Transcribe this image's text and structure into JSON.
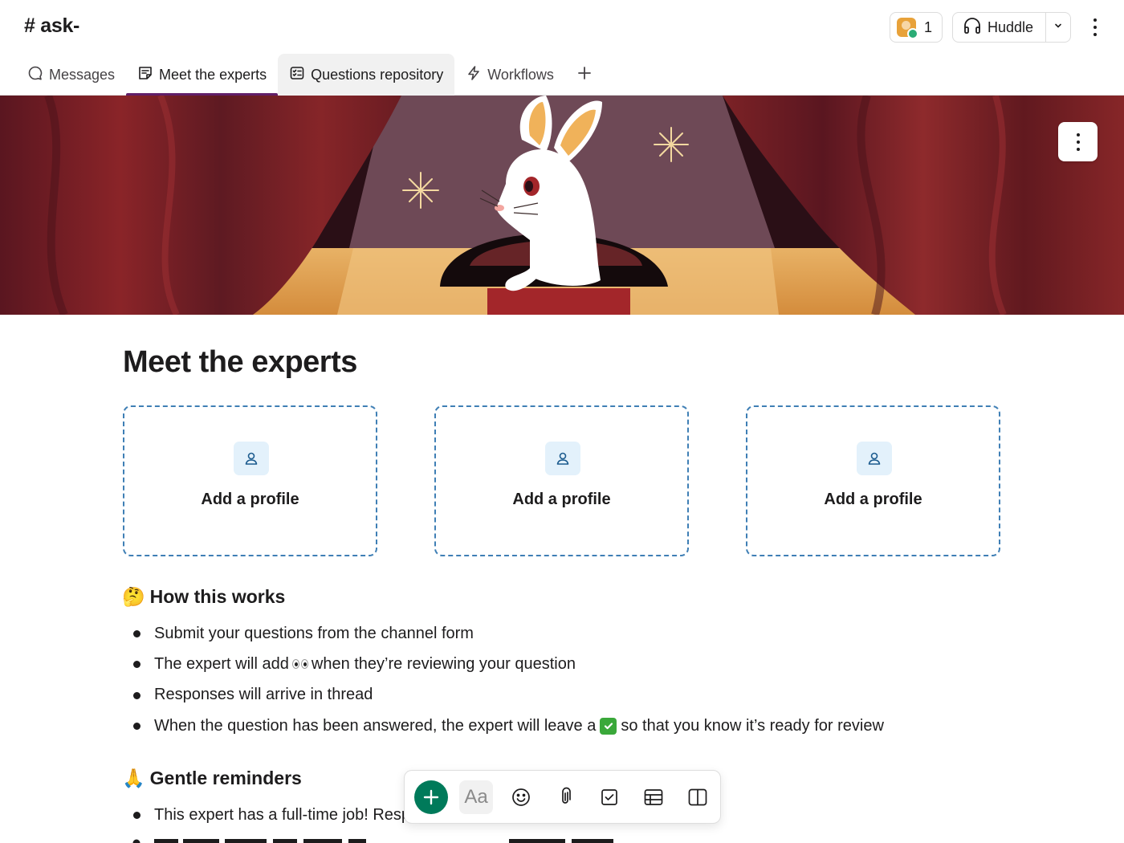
{
  "header": {
    "channel_title": "# ask-",
    "members_count": "1",
    "huddle_label": "Huddle"
  },
  "tabs": [
    {
      "label": "Messages",
      "icon": "chat-bubble-icon"
    },
    {
      "label": "Meet the experts",
      "icon": "canvas-icon",
      "selected": true
    },
    {
      "label": "Questions repository",
      "icon": "list-icon"
    },
    {
      "label": "Workflows",
      "icon": "lightning-icon"
    }
  ],
  "page": {
    "title": "Meet the experts",
    "profile_cards": [
      {
        "label": "Add a profile"
      },
      {
        "label": "Add a profile"
      },
      {
        "label": "Add a profile"
      }
    ],
    "how_it_works": {
      "emoji": "🤔",
      "title": "How this works",
      "items": [
        {
          "text": "Submit your questions from the channel form"
        },
        {
          "before": "The expert will add",
          "after": "when they’re reviewing your question"
        },
        {
          "text": "Responses will arrive in thread"
        },
        {
          "before": "When the question has been answered, the expert will leave a",
          "after": "so that you know it’s ready for review"
        }
      ]
    },
    "reminders": {
      "emoji": "🙏",
      "title": "Gentle reminders",
      "items": [
        {
          "text": "This expert has a full-time job! Resp"
        }
      ]
    }
  },
  "toolbar": {
    "text_format_label": "Aa"
  },
  "colors": {
    "tab_indicator": "#611f69",
    "card_border": "#3f7fb5",
    "add_button": "#007a5a"
  }
}
